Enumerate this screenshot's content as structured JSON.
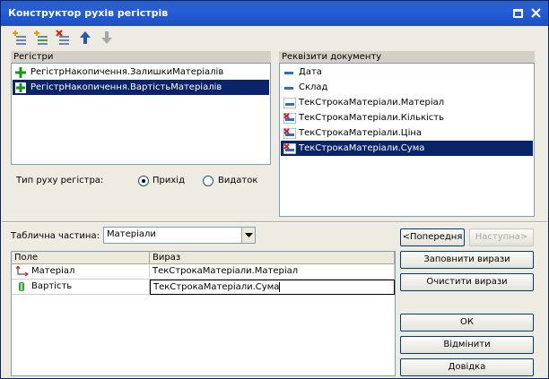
{
  "window": {
    "title": "Конструктор рухів регістрів"
  },
  "toolbar": {
    "icons": [
      "add-register-icon",
      "add-copy-icon",
      "delete-register-icon",
      "move-up-icon",
      "move-down-icon"
    ]
  },
  "registers": {
    "header": "Регістри",
    "items": [
      {
        "label": "РегістрНакопичення.ЗалишкиМатеріалів",
        "icon": "accumulation-register-icon"
      },
      {
        "label": "РегістрНакопичення.ВартістьМатеріалів",
        "icon": "accumulation-register-icon"
      }
    ]
  },
  "movement": {
    "label": "Тип руху регістра:",
    "options": [
      {
        "label": "Прихід",
        "selected": true
      },
      {
        "label": "Видаток",
        "selected": false
      }
    ]
  },
  "attributes": {
    "header": "Реквізити документу",
    "items": [
      {
        "label": "Дата",
        "icon": "attribute-icon"
      },
      {
        "label": "Склад",
        "icon": "attribute-icon"
      },
      {
        "label": "ТекСтрокаМатеріали.Матеріал",
        "icon": "table-attribute-icon"
      },
      {
        "label": "ТекСтрокаМатеріали.Кількість",
        "icon": "table-attribute-used-icon"
      },
      {
        "label": "ТекСтрокаМатеріали.Ціна",
        "icon": "table-attribute-used-icon"
      },
      {
        "label": "ТекСтрокаМатеріали.Сума",
        "icon": "table-attribute-used-icon"
      }
    ]
  },
  "tabular": {
    "label": "Таблична частина:",
    "value": "Матеріали"
  },
  "nav": {
    "prev": "<Попередня",
    "next": "Наступна>"
  },
  "grid": {
    "columns": [
      "Поле",
      "Вираз"
    ],
    "rows": [
      {
        "field": "Матеріал",
        "expr": "ТекСтрокаМатеріали.Матеріал",
        "icon": "dimension-icon"
      },
      {
        "field": "Вартість",
        "expr": "ТекСтрокаМатеріали.Сума",
        "icon": "resource-icon"
      }
    ]
  },
  "buttons": {
    "fill": "Заповнити вирази",
    "clear": "Очистити вирази",
    "ok": "ОК",
    "cancel": "Відмінити",
    "help": "Довідка"
  }
}
